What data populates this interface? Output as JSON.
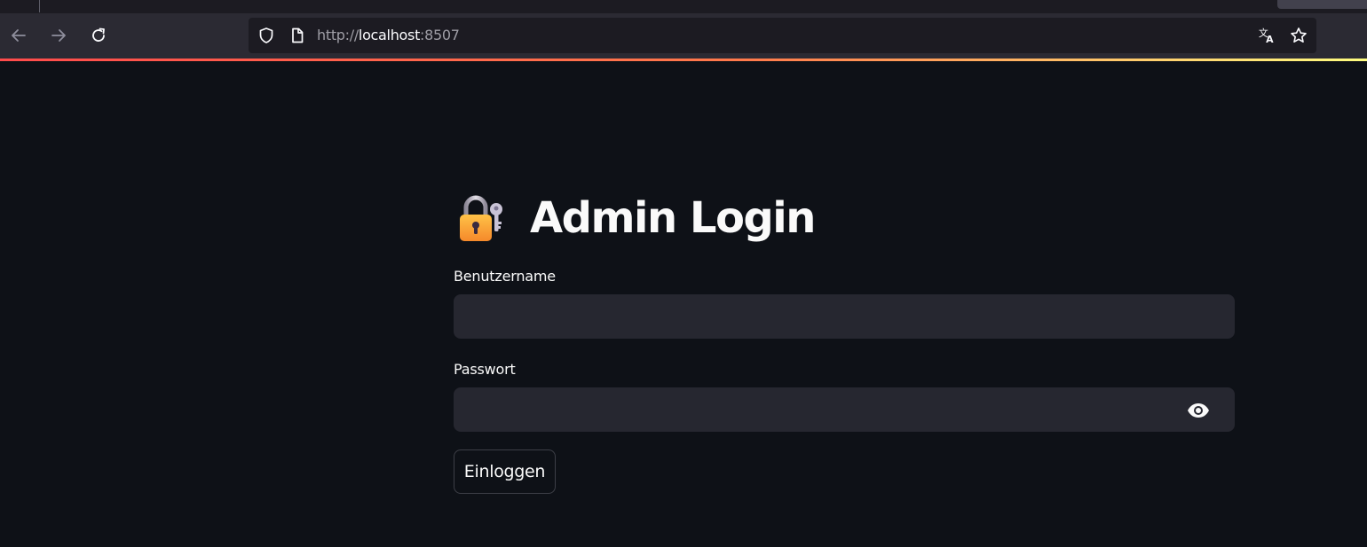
{
  "browser": {
    "url_scheme": "http://",
    "url_host": "localhost",
    "url_port": ":8507"
  },
  "page": {
    "title": "Admin Login",
    "title_icon": "locked-with-key-icon"
  },
  "form": {
    "username_label": "Benutzername",
    "username_value": "",
    "password_label": "Passwort",
    "password_value": "",
    "submit_label": "Einloggen"
  },
  "colors": {
    "background": "#0e1117",
    "input_background": "#262730",
    "text": "#fafafa",
    "browser_toolbar": "#2b2a33"
  }
}
